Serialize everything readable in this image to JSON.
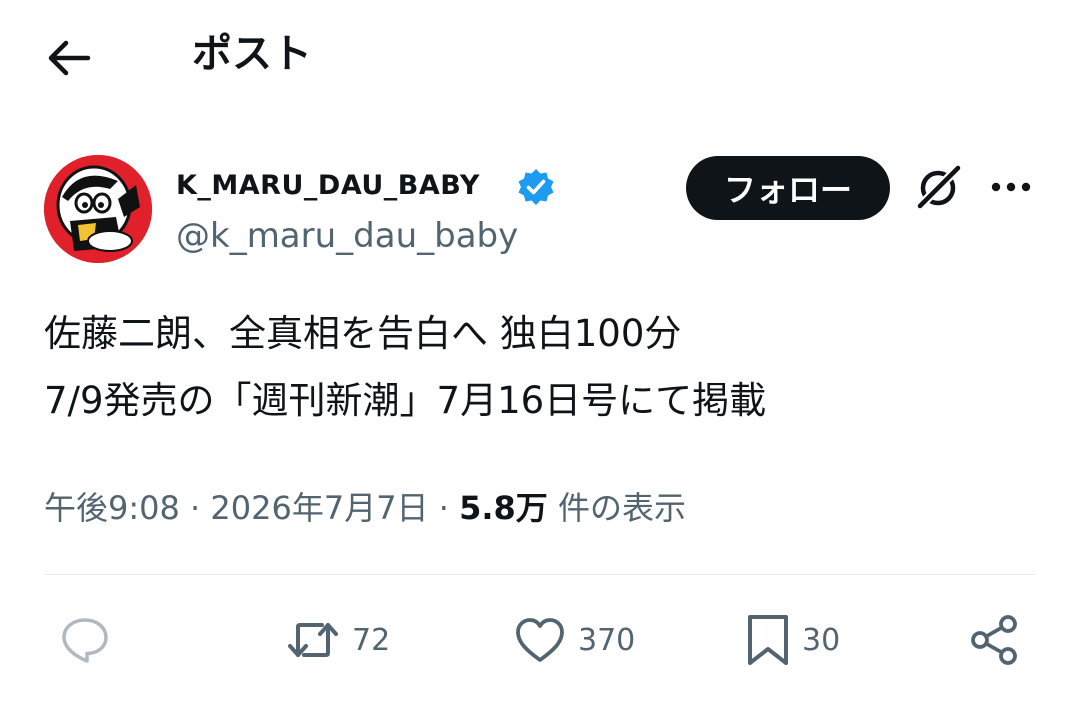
{
  "header": {
    "title": "ポスト"
  },
  "author": {
    "display_name": "K_MARU_DAU_BABY",
    "handle": "@k_maru_dau_baby",
    "follow_label": "フォロー",
    "more_label": "···",
    "verified_color": "#1d9bf0"
  },
  "tweet": {
    "lines": [
      "佐藤二朗、全真相を告白へ 独白100分",
      "7/9発売の「週刊新潮」7月16日号にて掲載"
    ]
  },
  "meta": {
    "time": "午後9:08",
    "date": "2026年7月7日",
    "separator": "·",
    "views_count": "5.8万",
    "views_label": "件の表示"
  },
  "actions": {
    "retweets": "72",
    "likes": "370",
    "bookmarks": "30"
  },
  "colors": {
    "text": "#0f1419",
    "secondary": "#536471",
    "accent": "#1d9bf0",
    "avatar_bg": "#e0202a"
  }
}
